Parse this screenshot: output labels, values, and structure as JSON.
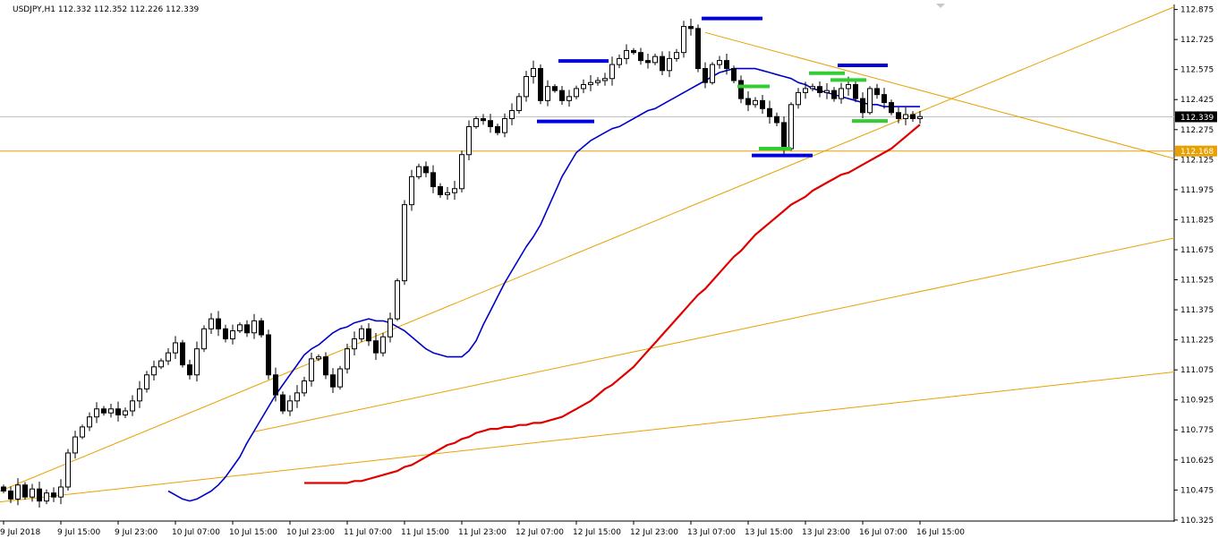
{
  "chart_data": {
    "type": "candlestick",
    "symbol": "USDJPY",
    "timeframe": "H1",
    "header": "USDJPY,H1  112.332 112.352 112.226 112.339",
    "ohlc_readout": {
      "open": 112.332,
      "high": 112.352,
      "low": 112.226,
      "close": 112.339
    },
    "ylim": [
      110.32,
      112.9
    ],
    "y_ticks": [
      "112.875",
      "112.725",
      "112.575",
      "112.425",
      "112.275",
      "112.125",
      "111.975",
      "111.825",
      "111.675",
      "111.525",
      "111.375",
      "111.225",
      "111.075",
      "110.925",
      "110.775",
      "110.625",
      "110.475",
      "110.325"
    ],
    "x_ticks": [
      {
        "label": "9 Jul 2018",
        "bar": 0
      },
      {
        "label": "9 Jul 15:00",
        "bar": 8
      },
      {
        "label": "9 Jul 23:00",
        "bar": 16
      },
      {
        "label": "10 Jul 07:00",
        "bar": 24
      },
      {
        "label": "10 Jul 15:00",
        "bar": 32
      },
      {
        "label": "10 Jul 23:00",
        "bar": 40
      },
      {
        "label": "11 Jul 07:00",
        "bar": 48
      },
      {
        "label": "11 Jul 15:00",
        "bar": 56
      },
      {
        "label": "11 Jul 23:00",
        "bar": 64
      },
      {
        "label": "12 Jul 07:00",
        "bar": 72
      },
      {
        "label": "12 Jul 15:00",
        "bar": 80
      },
      {
        "label": "12 Jul 23:00",
        "bar": 88
      },
      {
        "label": "13 Jul 07:00",
        "bar": 96
      },
      {
        "label": "13 Jul 15:00",
        "bar": 104
      },
      {
        "label": "13 Jul 23:00",
        "bar": 112
      },
      {
        "label": "16 Jul 07:00",
        "bar": 120
      },
      {
        "label": "16 Jul 15:00",
        "bar": 128
      }
    ],
    "current_price": {
      "value": 112.339,
      "label": "112.339"
    },
    "support_level": {
      "value": 112.168,
      "label": "112.168"
    },
    "closes": [
      110.47,
      110.43,
      110.5,
      110.44,
      110.48,
      110.42,
      110.46,
      110.44,
      110.49,
      110.66,
      110.74,
      110.79,
      110.84,
      110.88,
      110.86,
      110.88,
      110.85,
      110.87,
      110.92,
      110.98,
      111.05,
      111.09,
      111.12,
      111.16,
      111.21,
      111.1,
      111.05,
      111.18,
      111.28,
      111.33,
      111.28,
      111.23,
      111.27,
      111.3,
      111.26,
      111.32,
      111.25,
      111.05,
      110.95,
      110.87,
      110.92,
      110.96,
      111.02,
      111.13,
      111.14,
      111.05,
      110.99,
      111.08,
      111.18,
      111.23,
      111.28,
      111.22,
      111.16,
      111.24,
      111.33,
      111.52,
      111.9,
      112.04,
      112.09,
      112.06,
      111.99,
      111.95,
      111.96,
      111.98,
      112.15,
      112.29,
      112.33,
      112.32,
      112.29,
      112.26,
      112.33,
      112.37,
      112.44,
      112.54,
      112.58,
      112.42,
      112.49,
      112.47,
      112.42,
      112.44,
      112.48,
      112.5,
      112.51,
      112.52,
      112.53,
      112.6,
      112.63,
      112.67,
      112.66,
      112.62,
      112.61,
      112.64,
      112.57,
      112.63,
      112.66,
      112.79,
      112.78,
      112.58,
      112.51,
      112.6,
      112.62,
      112.58,
      112.52,
      112.43,
      112.4,
      112.42,
      112.38,
      112.34,
      112.31,
      112.18,
      112.4,
      112.46,
      112.48,
      112.49,
      112.46,
      112.47,
      112.43,
      112.48,
      112.5,
      112.43,
      112.36,
      112.48,
      112.45,
      112.41,
      112.36,
      112.33,
      112.35,
      112.33,
      112.34
    ],
    "series": [
      {
        "name": "",
        "color": "#0000c8",
        "values": [
          110.47,
          110.45,
          110.43,
          110.42,
          110.43,
          110.45,
          110.47,
          110.5,
          110.54,
          110.59,
          110.64,
          110.71,
          110.77,
          110.83,
          110.89,
          110.95,
          111.0,
          111.05,
          111.1,
          111.15,
          111.18,
          111.2,
          111.23,
          111.26,
          111.28,
          111.29,
          111.31,
          111.32,
          111.33,
          111.32,
          111.32,
          111.31,
          111.29,
          111.27,
          111.24,
          111.21,
          111.18,
          111.16,
          111.15,
          111.14,
          111.14,
          111.14,
          111.17,
          111.22,
          111.3,
          111.37,
          111.44,
          111.51,
          111.57,
          111.63,
          111.69,
          111.74,
          111.8,
          111.88,
          111.96,
          112.04,
          112.1,
          112.16,
          112.19,
          112.22,
          112.24,
          112.26,
          112.28,
          112.29,
          112.31,
          112.33,
          112.35,
          112.37,
          112.38,
          112.4,
          112.42,
          112.44,
          112.46,
          112.48,
          112.5,
          112.52,
          112.54,
          112.56,
          112.57,
          112.58,
          112.58,
          112.58,
          112.58,
          112.57,
          112.56,
          112.55,
          112.54,
          112.53,
          112.51,
          112.5,
          112.48,
          112.47,
          112.46,
          112.45,
          112.44,
          112.43,
          112.42,
          112.41,
          112.4,
          112.4,
          112.39,
          112.39,
          112.39,
          112.39,
          112.39,
          112.39
        ]
      },
      {
        "name": "",
        "color": "#e00000",
        "values": [
          110.51,
          110.51,
          110.51,
          110.51,
          110.51,
          110.51,
          110.51,
          110.52,
          110.52,
          110.53,
          110.54,
          110.55,
          110.56,
          110.57,
          110.59,
          110.6,
          110.62,
          110.64,
          110.66,
          110.68,
          110.7,
          110.71,
          110.73,
          110.74,
          110.76,
          110.77,
          110.78,
          110.78,
          110.79,
          110.79,
          110.8,
          110.8,
          110.81,
          110.81,
          110.82,
          110.83,
          110.84,
          110.86,
          110.88,
          110.9,
          110.92,
          110.95,
          110.98,
          111.0,
          111.03,
          111.06,
          111.09,
          111.13,
          111.17,
          111.21,
          111.25,
          111.29,
          111.33,
          111.37,
          111.41,
          111.45,
          111.48,
          111.52,
          111.56,
          111.6,
          111.64,
          111.67,
          111.71,
          111.75,
          111.78,
          111.81,
          111.84,
          111.87,
          111.9,
          111.92,
          111.94,
          111.97,
          111.99,
          112.01,
          112.03,
          112.05,
          112.06,
          112.08,
          112.1,
          112.12,
          112.14,
          112.16,
          112.18,
          112.21,
          112.24,
          112.27,
          112.3
        ]
      }
    ],
    "annotations": {
      "blue_levels": [
        {
          "bar1": 77.5,
          "bar2": 84.5,
          "price": 112.618
        },
        {
          "bar1": 74.5,
          "bar2": 82.5,
          "price": 112.316
        },
        {
          "bar1": 104.5,
          "bar2": 113,
          "price": 112.146
        },
        {
          "bar1": 97.5,
          "bar2": 106,
          "price": 112.83
        },
        {
          "bar1": 116.5,
          "bar2": 123.5,
          "price": 112.596
        }
      ],
      "green_levels": [
        {
          "bar1": 102.5,
          "bar2": 107,
          "price": 112.491
        },
        {
          "bar1": 105.5,
          "bar2": 110,
          "price": 112.18
        },
        {
          "bar1": 112.5,
          "bar2": 117.5,
          "price": 112.557
        },
        {
          "bar1": 115.5,
          "bar2": 120.5,
          "price": 112.523
        },
        {
          "bar1": 118.5,
          "bar2": 123.5,
          "price": 112.318
        }
      ],
      "trend_lines": [
        {
          "bar1": -12,
          "p1": 110.3,
          "bar2": 165,
          "p2": 112.91,
          "color": "#e8a000"
        },
        {
          "bar1": 35,
          "p1": 110.766,
          "bar2": 175,
          "p2": 111.82,
          "color": "#e8a000"
        },
        {
          "bar1": -12,
          "p1": 110.37,
          "bar2": 175,
          "p2": 111.11,
          "color": "#e8a000"
        },
        {
          "bar1": 98,
          "p1": 112.76,
          "bar2": 175,
          "p2": 112.02,
          "color": "#e8a000"
        }
      ]
    },
    "grid": false,
    "legend": "none"
  }
}
